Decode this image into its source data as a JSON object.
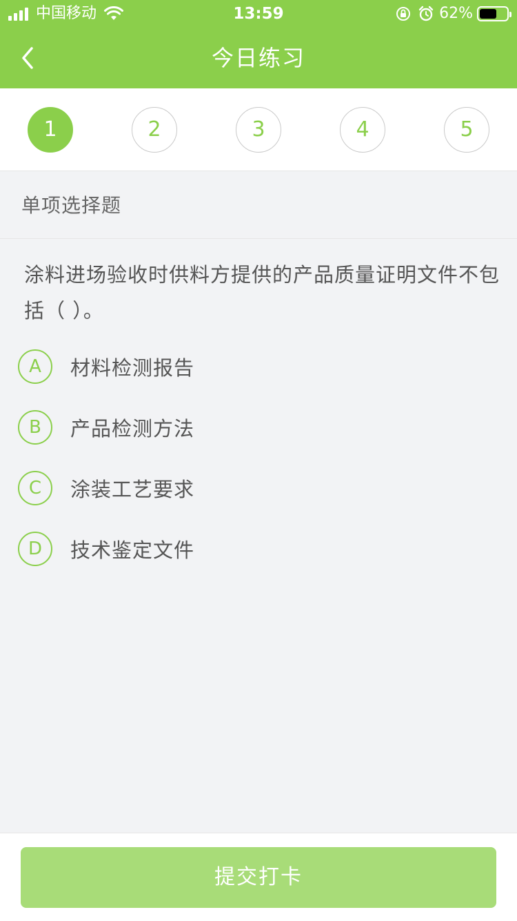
{
  "status_bar": {
    "carrier": "中国移动",
    "time": "13:59",
    "battery_percent": "62%",
    "battery_level": 0.62,
    "icons": [
      "signal-icon",
      "wifi-icon",
      "orientation-lock-icon",
      "alarm-icon",
      "battery-icon"
    ]
  },
  "nav": {
    "title": "今日练习",
    "back_icon": "chevron-left-icon"
  },
  "steps": {
    "items": [
      "1",
      "2",
      "3",
      "4",
      "5"
    ],
    "active_index": 0
  },
  "question": {
    "type_label": "单项选择题",
    "stem": "涂料进场验收时供料方提供的产品质量证明文件不包括（ ）。",
    "options": [
      {
        "key": "A",
        "text": "材料检测报告"
      },
      {
        "key": "B",
        "text": "产品检测方法"
      },
      {
        "key": "C",
        "text": "涂装工艺要求"
      },
      {
        "key": "D",
        "text": "技术鉴定文件"
      }
    ]
  },
  "footer": {
    "submit_label": "提交打卡"
  },
  "colors": {
    "brand_green": "#8bcf4b",
    "submit_disabled": "#a8dc78",
    "page_background": "#f2f3f5",
    "text": "#555555"
  }
}
